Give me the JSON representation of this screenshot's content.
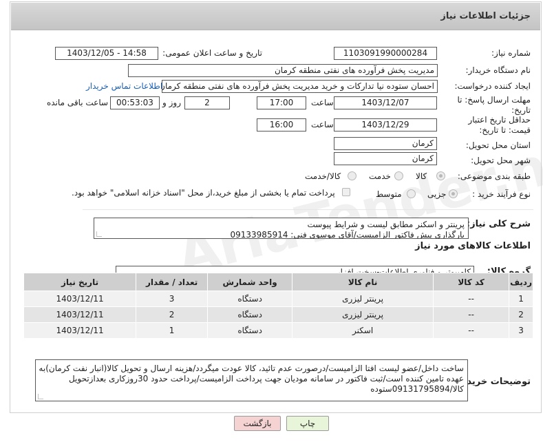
{
  "header": {
    "title": "جزئیات اطلاعات نیاز"
  },
  "fields": {
    "need_number_label": "شماره نیاز:",
    "need_number": "1103091990000284",
    "announce_label": "تاریخ و ساعت اعلان عمومی:",
    "announce_value": "1403/12/05 - 14:58",
    "buyer_label": "نام دستگاه خریدار:",
    "buyer_value": "مدیریت پخش فرآورده های نفتی منطقه کرمان",
    "creator_label": "ایجاد کننده درخواست:",
    "creator_value": "احسان  ستوده نیا  تدارکات و خرید  مدیریت پخش فرآورده های نفتی منطقه کرمان",
    "contact_link": "اطلاعات تماس خریدار",
    "deadline_label": "مهلت ارسال پاسخ: تا تاریخ:",
    "deadline_date": "1403/12/07",
    "time_label": "ساعت",
    "deadline_time": "17:00",
    "days_value": "2",
    "days_label": "روز و",
    "remaining_time": "00:53:03",
    "remaining_label": "ساعت باقی مانده",
    "validity_label": "حداقل تاریخ اعتبار قیمت: تا تاریخ:",
    "validity_date": "1403/12/29",
    "validity_time": "16:00",
    "province_label": "استان محل تحویل:",
    "province_value": "کرمان",
    "city_label": "شهر محل تحویل:",
    "city_value": "کرمان",
    "category_label": "طبقه بندی موضوعی:",
    "category_options": [
      "کالا",
      "خدمت",
      "کالا/خدمت"
    ],
    "process_label": "نوع فرآیند خرید :",
    "process_options": [
      "جزیی",
      "متوسط"
    ],
    "payment_note": "پرداخت تمام یا بخشی از مبلغ خرید،از محل \"اسناد خزانه اسلامی\" خواهد بود."
  },
  "description": {
    "label": "شرح کلی نیاز:",
    "line1": "پرینتر و اسکنر مطابق لیست و شرایط پیوست",
    "line2": "بارگذاری پیش فاکتور الزامیست/آقای موسوی فنی: 09133985914"
  },
  "goods": {
    "section_title": "اطلاعات کالاهای مورد نیاز",
    "group_label": "گروه کالا:",
    "group_value": "کامپیوتر و فناوری اطلاعات-سخت افزار"
  },
  "table": {
    "headers": [
      "ردیف",
      "کد کالا",
      "نام کالا",
      "واحد شمارش",
      "تعداد / مقدار",
      "تاریخ نیاز"
    ],
    "rows": [
      [
        "1",
        "--",
        "پرینتر لیزری",
        "دستگاه",
        "3",
        "1403/12/11"
      ],
      [
        "2",
        "--",
        "پرینتر لیزری",
        "دستگاه",
        "2",
        "1403/12/11"
      ],
      [
        "3",
        "--",
        "اسکنر",
        "دستگاه",
        "1",
        "1403/12/11"
      ]
    ]
  },
  "buyer_notes": {
    "label": "توضیحات خریدار:",
    "line1": "ساخت داخل/عضو لیست افتا الزامیست/درصورت عدم تائید، کالا عودت میگردد/هزینه ارسال و تحویل کالا(انبار نفت کرمان)به",
    "line2": "عهده تامین کننده است/ثبت فاکتور در سامانه مودیان جهت پرداخت الزامیست/پرداخت حدود 30روزکاری بعدازتحویل",
    "line3": "کالا/09131795894ستوده"
  },
  "buttons": {
    "print": "چاپ",
    "back": "بازگشت"
  },
  "watermark": "AriaTender.neT",
  "colors": {
    "header_bg": "#c9c9c9",
    "link": "#1a5fb4",
    "back_btn": "#f6d3d3",
    "print_btn": "#e8f5d8"
  }
}
